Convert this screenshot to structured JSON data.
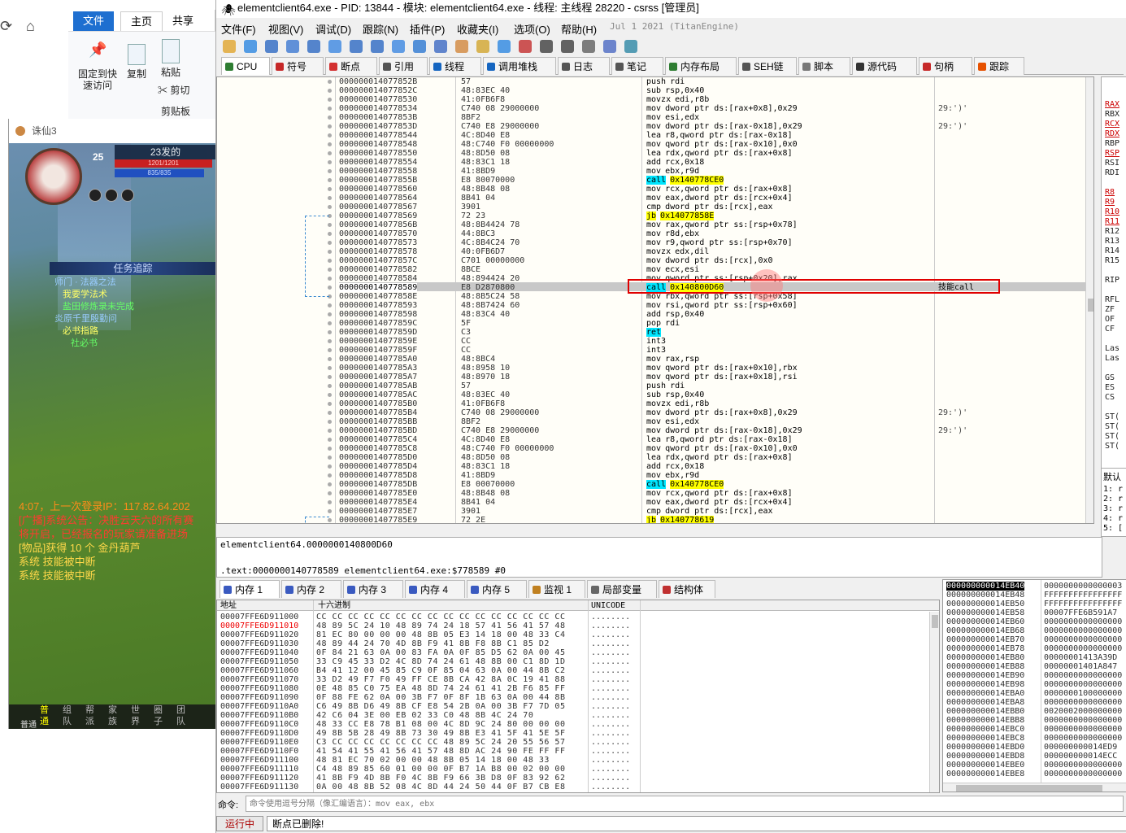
{
  "explorer": {
    "tabs": [
      "文件",
      "主页",
      "共享"
    ],
    "buttons": {
      "pin": "固定到快\n速访问",
      "copy": "复制",
      "paste": "粘贴",
      "cut": "剪切"
    },
    "group": "剪贴板"
  },
  "game": {
    "title": "诛仙3",
    "level": "25",
    "player_name": "23发的",
    "hp": "1201/1201",
    "mp": "835/835",
    "quest_header": "任务追踪",
    "quests": [
      "师门 · 法器之法",
      "我要学法术",
      "盐田修炼录未完成",
      "炎原千里殷勤问",
      "必书指路",
      "社必书"
    ],
    "chat": [
      {
        "text": "4:07，上一次登录IP：117.82.64.202",
        "color": "#ff8c1a"
      },
      {
        "text": "[广播]系统公告：决胜云天六的所有赛",
        "color": "#ff3b30"
      },
      {
        "text": "将开启，已经报名的玩家请准备进场",
        "color": "#ff3b30"
      },
      {
        "text": "[物品]获得 10 个 金丹葫芦",
        "color": "#ffd84a"
      },
      {
        "text": "系统 技能被中断",
        "color": "#ffd84a"
      },
      {
        "text": "系统 技能被中断",
        "color": "#ffd84a"
      }
    ],
    "chat_tabs": [
      "普通",
      "组队",
      "帮派",
      "家族",
      "世界",
      "圈子",
      "团队"
    ],
    "input_label": "普通"
  },
  "dbg": {
    "title": "elementclient64.exe - PID: 13844 - 模块: elementclient64.exe - 线程: 主线程 28220 - csrss [管理员]",
    "menu": [
      "文件(F)",
      "视图(V)",
      "调试(D)",
      "跟踪(N)",
      "插件(P)",
      "收藏夹(I)",
      "选项(O)",
      "帮助(H)",
      "Jul 1 2021 (TitanEngine)"
    ],
    "tabs": [
      "CPU",
      "符号",
      "断点",
      "引用",
      "线程",
      "调用堆栈",
      "日志",
      "笔记",
      "内存布局",
      "SEH链",
      "脚本",
      "源代码",
      "句柄",
      "跟踪"
    ],
    "tab_colors": [
      "#2e7d32",
      "#c62828",
      "#d32f2f",
      "#555555",
      "#1565c0",
      "#1565c0",
      "#555555",
      "#555555",
      "#2e7d32",
      "#555555",
      "#777777",
      "#333333",
      "#c62828",
      "#e65100"
    ],
    "rows": [
      {
        "addr": "000000014077852B",
        "bytes": "57",
        "dis": "push rdi",
        "cmt": ""
      },
      {
        "addr": "000000014077852C",
        "bytes": "48:83EC 40",
        "dis": "sub rsp,0x40",
        "cmt": ""
      },
      {
        "addr": "0000000140778530",
        "bytes": "41:0FB6F8",
        "dis": "movzx edi,r8b",
        "cmt": ""
      },
      {
        "addr": "0000000140778534",
        "bytes": "C740 08 29000000",
        "dis": "mov dword ptr ds:[rax+0x8],0x29",
        "cmt": "29:')'"
      },
      {
        "addr": "000000014077853B",
        "bytes": "8BF2",
        "dis": "mov esi,edx",
        "cmt": ""
      },
      {
        "addr": "000000014077853D",
        "bytes": "C740 E8 29000000",
        "dis": "mov dword ptr ds:[rax-0x18],0x29",
        "cmt": "29:')'"
      },
      {
        "addr": "0000000140778544",
        "bytes": "4C:8D40 E8",
        "dis": "lea r8,qword ptr ds:[rax-0x18]",
        "cmt": ""
      },
      {
        "addr": "0000000140778548",
        "bytes": "48:C740 F0 00000000",
        "dis": "mov qword ptr ds:[rax-0x10],0x0",
        "cmt": ""
      },
      {
        "addr": "0000000140778550",
        "bytes": "48:8D50 08",
        "dis": "lea rdx,qword ptr ds:[rax+0x8]",
        "cmt": ""
      },
      {
        "addr": "0000000140778554",
        "bytes": "48:83C1 18",
        "dis": "add rcx,0x18",
        "cmt": ""
      },
      {
        "addr": "0000000140778558",
        "bytes": "41:8BD9",
        "dis": "mov ebx,r9d",
        "cmt": ""
      },
      {
        "addr": "000000014077855B",
        "bytes": "E8 80070000",
        "dis": "call 0x140778CE0",
        "cmt": "",
        "kind": "call"
      },
      {
        "addr": "0000000140778560",
        "bytes": "48:8B48 08",
        "dis": "mov rcx,qword ptr ds:[rax+0x8]",
        "cmt": ""
      },
      {
        "addr": "0000000140778564",
        "bytes": "8B41 04",
        "dis": "mov eax,dword ptr ds:[rcx+0x4]",
        "cmt": ""
      },
      {
        "addr": "0000000140778567",
        "bytes": "3901",
        "dis": "cmp dword ptr ds:[rcx],eax",
        "cmt": ""
      },
      {
        "addr": "0000000140778569",
        "bytes": "72 23",
        "dis": "jb 0x14077858E",
        "cmt": "",
        "kind": "jmp"
      },
      {
        "addr": "000000014077856B",
        "bytes": "48:8B4424 78",
        "dis": "mov rax,qword ptr ss:[rsp+0x78]",
        "cmt": ""
      },
      {
        "addr": "0000000140778570",
        "bytes": "44:8BC3",
        "dis": "mov r8d,ebx",
        "cmt": ""
      },
      {
        "addr": "0000000140778573",
        "bytes": "4C:8B4C24 70",
        "dis": "mov r9,qword ptr ss:[rsp+0x70]",
        "cmt": ""
      },
      {
        "addr": "0000000140778578",
        "bytes": "40:0FB6D7",
        "dis": "movzx edx,dil",
        "cmt": ""
      },
      {
        "addr": "000000014077857C",
        "bytes": "C701 00000000",
        "dis": "mov dword ptr ds:[rcx],0x0",
        "cmt": ""
      },
      {
        "addr": "0000000140778582",
        "bytes": "8BCE",
        "dis": "mov ecx,esi",
        "cmt": ""
      },
      {
        "addr": "0000000140778584",
        "bytes": "48:894424 20",
        "dis": "mov qword ptr ss:[rsp+0x20],rax",
        "cmt": ""
      },
      {
        "addr": "0000000140778589",
        "bytes": "E8 D2870800",
        "dis": "call 0x140800D60",
        "cmt": "技能call",
        "kind": "call",
        "selected": true
      },
      {
        "addr": "000000014077858E",
        "bytes": "48:8B5C24 58",
        "dis": "mov rbx,qword ptr ss:[rsp+0x58]",
        "cmt": ""
      },
      {
        "addr": "0000000140778593",
        "bytes": "48:8B7424 60",
        "dis": "mov rsi,qword ptr ss:[rsp+0x60]",
        "cmt": ""
      },
      {
        "addr": "0000000140778598",
        "bytes": "48:83C4 40",
        "dis": "add rsp,0x40",
        "cmt": ""
      },
      {
        "addr": "000000014077859C",
        "bytes": "5F",
        "dis": "pop rdi",
        "cmt": ""
      },
      {
        "addr": "000000014077859D",
        "bytes": "C3",
        "dis": "ret",
        "cmt": "",
        "kind": "ret"
      },
      {
        "addr": "000000014077859E",
        "bytes": "CC",
        "dis": "int3",
        "cmt": ""
      },
      {
        "addr": "000000014077859F",
        "bytes": "CC",
        "dis": "int3",
        "cmt": ""
      },
      {
        "addr": "00000001407785A0",
        "bytes": "48:8BC4",
        "dis": "mov rax,rsp",
        "cmt": ""
      },
      {
        "addr": "00000001407785A3",
        "bytes": "48:8958 10",
        "dis": "mov qword ptr ds:[rax+0x10],rbx",
        "cmt": ""
      },
      {
        "addr": "00000001407785A7",
        "bytes": "48:8970 18",
        "dis": "mov qword ptr ds:[rax+0x18],rsi",
        "cmt": ""
      },
      {
        "addr": "00000001407785AB",
        "bytes": "57",
        "dis": "push rdi",
        "cmt": ""
      },
      {
        "addr": "00000001407785AC",
        "bytes": "48:83EC 40",
        "dis": "sub rsp,0x40",
        "cmt": ""
      },
      {
        "addr": "00000001407785B0",
        "bytes": "41:0FB6F8",
        "dis": "movzx edi,r8b",
        "cmt": ""
      },
      {
        "addr": "00000001407785B4",
        "bytes": "C740 08 29000000",
        "dis": "mov dword ptr ds:[rax+0x8],0x29",
        "cmt": "29:')'"
      },
      {
        "addr": "00000001407785BB",
        "bytes": "8BF2",
        "dis": "mov esi,edx",
        "cmt": ""
      },
      {
        "addr": "00000001407785BD",
        "bytes": "C740 E8 29000000",
        "dis": "mov dword ptr ds:[rax-0x18],0x29",
        "cmt": "29:')'"
      },
      {
        "addr": "00000001407785C4",
        "bytes": "4C:8D40 E8",
        "dis": "lea r8,qword ptr ds:[rax-0x18]",
        "cmt": ""
      },
      {
        "addr": "00000001407785C8",
        "bytes": "48:C740 F0 00000000",
        "dis": "mov qword ptr ds:[rax-0x10],0x0",
        "cmt": ""
      },
      {
        "addr": "00000001407785D0",
        "bytes": "48:8D50 08",
        "dis": "lea rdx,qword ptr ds:[rax+0x8]",
        "cmt": ""
      },
      {
        "addr": "00000001407785D4",
        "bytes": "48:83C1 18",
        "dis": "add rcx,0x18",
        "cmt": ""
      },
      {
        "addr": "00000001407785D8",
        "bytes": "41:8BD9",
        "dis": "mov ebx,r9d",
        "cmt": ""
      },
      {
        "addr": "00000001407785DB",
        "bytes": "E8 00070000",
        "dis": "call 0x140778CE0",
        "cmt": "",
        "kind": "call"
      },
      {
        "addr": "00000001407785E0",
        "bytes": "48:8B48 08",
        "dis": "mov rcx,qword ptr ds:[rax+0x8]",
        "cmt": ""
      },
      {
        "addr": "00000001407785E4",
        "bytes": "8B41 04",
        "dis": "mov eax,dword ptr ds:[rcx+0x4]",
        "cmt": ""
      },
      {
        "addr": "00000001407785E7",
        "bytes": "3901",
        "dis": "cmp dword ptr ds:[rcx],eax",
        "cmt": ""
      },
      {
        "addr": "00000001407785E9",
        "bytes": "72 2E",
        "dis": "jb 0x140778619",
        "cmt": "",
        "kind": "jmp"
      }
    ],
    "registers": [
      "RAX",
      "RBX",
      "RCX",
      "RDX",
      "RBP",
      "RSP",
      "RSI",
      "RDI",
      "",
      "R8",
      "R9",
      "R10",
      "R11",
      "R12",
      "R13",
      "R14",
      "R15",
      "",
      "RIP",
      "",
      "RFL",
      "ZF",
      "OF",
      "CF",
      "",
      "Las",
      "Las",
      "",
      "GS",
      "ES",
      "CS",
      "",
      "ST(",
      "ST(",
      "ST(",
      "ST("
    ],
    "callstack_title": "默认",
    "callstack": [
      "1: r",
      "2: r",
      "3: r",
      "4: r",
      "5: ["
    ],
    "info_line1": "elementclient64.0000000140800D60",
    "info_line2": ".text:0000000140778589 elementclient64.exe:$778589 #0",
    "mem_tabs": [
      "内存 1",
      "内存 2",
      "内存 3",
      "内存 4",
      "内存 5",
      "监视 1",
      "局部变量",
      "结构体"
    ],
    "dump_headers": {
      "addr": "地址",
      "hex": "十六进制",
      "unicode": "UNICODE"
    },
    "dump": [
      {
        "addr": "00007FFE6D911000",
        "hex": "CC CC CC CC CC CC CC CC CC CC CC CC CC CC CC CC",
        "uni": "........"
      },
      {
        "addr": "00007FFE6D911010",
        "hex": "48 89 5C 24 10 48 89 74 24 18 57 41 56 41 57 48",
        "uni": "........",
        "red": true
      },
      {
        "addr": "00007FFE6D911020",
        "hex": "81 EC 80 00 00 00 48 8B 05 E3 14 18 00 48 33 C4",
        "uni": "........"
      },
      {
        "addr": "00007FFE6D911030",
        "hex": "48 89 44 24 70 4D 8B F9 41 8B F8 8B C1 85 D2",
        "uni": "........"
      },
      {
        "addr": "00007FFE6D911040",
        "hex": "0F 84 21 63 0A 00 83 FA 0A 0F 85 D5 62 0A 00 45",
        "uni": "........"
      },
      {
        "addr": "00007FFE6D911050",
        "hex": "33 C9 45 33 D2 4C 8D 74 24 61 48 8B 00 C1 8D 1D",
        "uni": "........"
      },
      {
        "addr": "00007FFE6D911060",
        "hex": "B4 41 12 00 45 85 C9 0F 85 04 63 0A 00 44 8B C2",
        "uni": "........"
      },
      {
        "addr": "00007FFE6D911070",
        "hex": "33 D2 49 F7 F0 49 FF CE 8B CA 42 8A 0C 19 41 88",
        "uni": "........"
      },
      {
        "addr": "00007FFE6D911080",
        "hex": "0E 48 85 C0 75 EA 48 8D 74 24 61 41 2B F6 85 FF",
        "uni": "........"
      },
      {
        "addr": "00007FFE6D911090",
        "hex": "0F 88 FE 62 0A 00 3B F7 0F 8F 1B 63 0A 00 44 8B",
        "uni": "........"
      },
      {
        "addr": "00007FFE6D9110A0",
        "hex": "C6 49 8B D6 49 8B CF E8 54 2B 0A 00 3B F7 7D 05",
        "uni": "........"
      },
      {
        "addr": "00007FFE6D9110B0",
        "hex": "42 C6 04 3E 00 EB 02 33 C0 48 8B 4C 24 70",
        "uni": "........"
      },
      {
        "addr": "00007FFE6D9110C0",
        "hex": "48 33 CC E8 78 B1 08 00 4C 8D 9C 24 80 00 00 00",
        "uni": "........"
      },
      {
        "addr": "00007FFE6D9110D0",
        "hex": "49 8B 5B 28 49 8B 73 30 49 8B E3 41 5F 41 5E 5F",
        "uni": "........"
      },
      {
        "addr": "00007FFE6D9110E0",
        "hex": "C3 CC CC CC CC CC CC CC 48 89 5C 24 20 55 56 57",
        "uni": "........"
      },
      {
        "addr": "00007FFE6D9110F0",
        "hex": "41 54 41 55 41 56 41 57 48 8D AC 24 90 FE FF FF",
        "uni": "........"
      },
      {
        "addr": "00007FFE6D911100",
        "hex": "48 81 EC 70 02 00 00 48 8B 05 14 18 00 48 33",
        "uni": "........"
      },
      {
        "addr": "00007FFE6D911110",
        "hex": "C4 48 89 85 60 01 00 00 0F B7 1A B8 00 02 00 00",
        "uni": "........"
      },
      {
        "addr": "00007FFE6D911120",
        "hex": "41 8B F9 4D 8B F0 4C 8B F9 66 3B D8 0F 83 92 62",
        "uni": "........"
      },
      {
        "addr": "00007FFE6D911130",
        "hex": "0A 00 48 8B 52 08 4C 8D 44 24 50 44 0F B7 CB E8",
        "uni": "........"
      }
    ],
    "stack": [
      {
        "addr": "000000000014EB40",
        "val": "0000000000000003"
      },
      {
        "addr": "000000000014EB48",
        "val": "FFFFFFFFFFFFFFFF"
      },
      {
        "addr": "000000000014EB50",
        "val": "FFFFFFFFFFFFFFFF"
      },
      {
        "addr": "000000000014EB58",
        "val": "00007FFE6B591A7"
      },
      {
        "addr": "000000000014EB60",
        "val": "0000000000000000"
      },
      {
        "addr": "000000000014EB68",
        "val": "0000000000000000"
      },
      {
        "addr": "000000000014EB70",
        "val": "0000000000000000"
      },
      {
        "addr": "000000000014EB78",
        "val": "0000000000000000"
      },
      {
        "addr": "000000000014EB80",
        "val": "00000001413A39D"
      },
      {
        "addr": "000000000014EB88",
        "val": "00000001401A847"
      },
      {
        "addr": "000000000014EB90",
        "val": "0000000000000000"
      },
      {
        "addr": "000000000014EB98",
        "val": "0000000000000000"
      },
      {
        "addr": "000000000014EBA0",
        "val": "0000000100000000"
      },
      {
        "addr": "000000000014EBA8",
        "val": "0000000000000000"
      },
      {
        "addr": "000000000014EBB0",
        "val": "0020002000000000"
      },
      {
        "addr": "000000000014EBB8",
        "val": "0000000000000000"
      },
      {
        "addr": "000000000014EBC0",
        "val": "0000000000000000"
      },
      {
        "addr": "000000000014EBC8",
        "val": "0000000000000000"
      },
      {
        "addr": "000000000014EBD0",
        "val": "000000000014ED9"
      },
      {
        "addr": "000000000014EBD8",
        "val": "000000000014ECC"
      },
      {
        "addr": "000000000014EBE0",
        "val": "0000000000000000"
      },
      {
        "addr": "000000000014EBE8",
        "val": "0000000000000000"
      }
    ],
    "cmd_label": "命令:",
    "cmd_placeholder": "命令使用逗号分隔（像汇编语言）：mov eax, ebx",
    "status_state": "运行中",
    "status_msg": "断点已删除!"
  }
}
